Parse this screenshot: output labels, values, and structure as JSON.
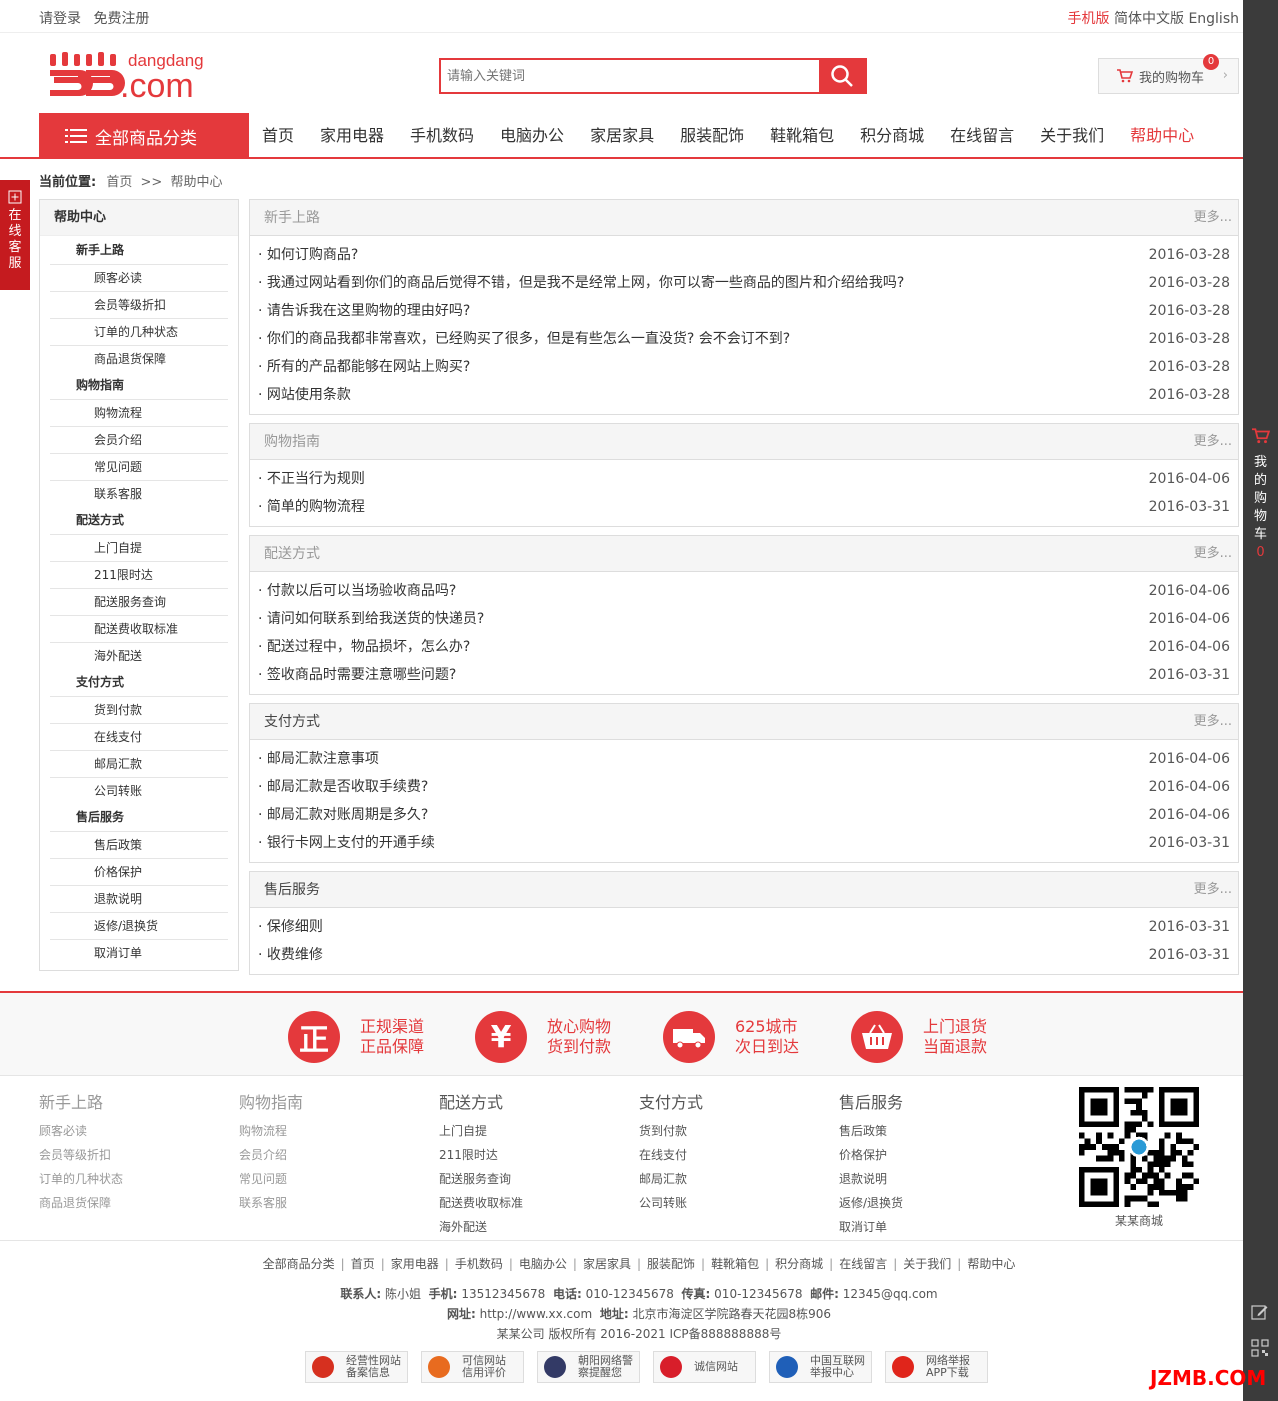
{
  "topbar": {
    "login": "请登录",
    "register": "免费注册",
    "mobile": "手机版",
    "lang_cn": "简体中文版",
    "lang_en": "English"
  },
  "logo": {
    "text": "dangdang",
    "domain": ".com"
  },
  "search": {
    "placeholder": "请输入关键词"
  },
  "cart": {
    "label": "我的购物车",
    "count": "0"
  },
  "nav": {
    "all_categories": "全部商品分类",
    "items": [
      "首页",
      "家用电器",
      "手机数码",
      "电脑办公",
      "家居家具",
      "服装配饰",
      "鞋靴箱包",
      "积分商城",
      "在线留言",
      "关于我们",
      "帮助中心"
    ]
  },
  "float_service": [
    "在",
    "线",
    "客",
    "服"
  ],
  "breadcrumb": {
    "label": "当前位置:",
    "home": "首页",
    "sep": ">>",
    "current": "帮助中心"
  },
  "sidebar": {
    "title": "帮助中心",
    "groups": [
      {
        "name": "新手上路",
        "items": [
          "顾客必读",
          "会员等级折扣",
          "订单的几种状态",
          "商品退货保障"
        ]
      },
      {
        "name": "购物指南",
        "items": [
          "购物流程",
          "会员介绍",
          "常见问题",
          "联系客服"
        ]
      },
      {
        "name": "配送方式",
        "items": [
          "上门自提",
          "211限时达",
          "配送服务查询",
          "配送费收取标准",
          "海外配送"
        ]
      },
      {
        "name": "支付方式",
        "items": [
          "货到付款",
          "在线支付",
          "邮局汇款",
          "公司转账"
        ]
      },
      {
        "name": "售后服务",
        "items": [
          "售后政策",
          "价格保护",
          "退款说明",
          "返修/退换货",
          "取消订单"
        ]
      }
    ]
  },
  "panels": [
    {
      "title": "新手上路",
      "more": "更多...",
      "rows": [
        {
          "t": "如何订购商品?",
          "d": "2016-03-28"
        },
        {
          "t": "我通过网站看到你们的商品后觉得不错，但是我不是经常上网，你可以寄一些商品的图片和介绍给我吗?",
          "d": "2016-03-28"
        },
        {
          "t": "请告诉我在这里购物的理由好吗?",
          "d": "2016-03-28"
        },
        {
          "t": "你们的商品我都非常喜欢，已经购买了很多，但是有些怎么一直没货? 会不会订不到?",
          "d": "2016-03-28"
        },
        {
          "t": "所有的产品都能够在网站上购买?",
          "d": "2016-03-28"
        },
        {
          "t": "网站使用条款",
          "d": "2016-03-28"
        }
      ]
    },
    {
      "title": "购物指南",
      "more": "更多...",
      "rows": [
        {
          "t": "不正当行为规则",
          "d": "2016-04-06"
        },
        {
          "t": "简单的购物流程",
          "d": "2016-03-31"
        }
      ]
    },
    {
      "title": "配送方式",
      "more": "更多...",
      "rows": [
        {
          "t": "付款以后可以当场验收商品吗?",
          "d": "2016-04-06"
        },
        {
          "t": "请问如何联系到给我送货的快递员?",
          "d": "2016-04-06"
        },
        {
          "t": "配送过程中，物品损坏，怎么办?",
          "d": "2016-04-06"
        },
        {
          "t": "签收商品时需要注意哪些问题?",
          "d": "2016-03-31"
        }
      ]
    },
    {
      "title": "支付方式",
      "more": "更多...",
      "rows": [
        {
          "t": "邮局汇款注意事项",
          "d": "2016-04-06"
        },
        {
          "t": "邮局汇款是否收取手续费?",
          "d": "2016-04-06"
        },
        {
          "t": "邮局汇款对账周期是多久?",
          "d": "2016-04-06"
        },
        {
          "t": "银行卡网上支付的开通手续",
          "d": "2016-03-31"
        }
      ]
    },
    {
      "title": "售后服务",
      "more": "更多...",
      "rows": [
        {
          "t": "保修细则",
          "d": "2016-03-31"
        },
        {
          "t": "收费维修",
          "d": "2016-03-31"
        }
      ]
    }
  ],
  "guarantees": [
    {
      "icon": "正",
      "l1": "正规渠道",
      "l2": "正品保障"
    },
    {
      "icon": "¥",
      "l1": "放心购物",
      "l2": "货到付款"
    },
    {
      "icon": "truck-icon",
      "l1": "625城市",
      "l2": "次日到达"
    },
    {
      "icon": "basket-icon",
      "l1": "上门退货",
      "l2": "当面退款"
    }
  ],
  "footer_cols": [
    {
      "title": "新手上路",
      "items": [
        "顾客必读",
        "会员等级折扣",
        "订单的几种状态",
        "商品退货保障"
      ]
    },
    {
      "title": "购物指南",
      "items": [
        "购物流程",
        "会员介绍",
        "常见问题",
        "联系客服"
      ]
    },
    {
      "title": "配送方式",
      "items": [
        "上门自提",
        "211限时达",
        "配送服务查询",
        "配送费收取标准",
        "海外配送"
      ]
    },
    {
      "title": "支付方式",
      "items": [
        "货到付款",
        "在线支付",
        "邮局汇款",
        "公司转账"
      ]
    },
    {
      "title": "售后服务",
      "items": [
        "售后政策",
        "价格保护",
        "退款说明",
        "返修/退换货",
        "取消订单"
      ]
    }
  ],
  "qr_label": "某某商城",
  "footer_links": [
    "全部商品分类",
    "首页",
    "家用电器",
    "手机数码",
    "电脑办公",
    "家居家具",
    "服装配饰",
    "鞋靴箱包",
    "积分商城",
    "在线留言",
    "关于我们",
    "帮助中心"
  ],
  "contact": {
    "k1": "联系人:",
    "v1": "陈小姐",
    "k2": "手机:",
    "v2": "13512345678",
    "k3": "电话:",
    "v3": "010-12345678",
    "k4": "传真:",
    "v4": "010-12345678",
    "k5": "邮件:",
    "v5": "12345@qq.com"
  },
  "site": {
    "k1": "网址:",
    "v1": "http://www.xx.com",
    "k2": "地址:",
    "v2": "北京市海淀区学院路春天花园8栋906"
  },
  "copyright": "某某公司 版权所有 2016-2021 ICP备888888888号",
  "badges": [
    {
      "l1": "经营性网站",
      "l2": "备案信息",
      "color": "#d6301f"
    },
    {
      "l1": "可信网站",
      "l2": "信用评价",
      "color": "#e86b1f"
    },
    {
      "l1": "朝阳网络警",
      "l2": "察提醒您",
      "color": "#333a66"
    },
    {
      "l1": "诚信网站",
      "l2": "",
      "color": "#d81e2a"
    },
    {
      "l1": "中国互联网",
      "l2": "举报中心",
      "color": "#1f5fb8"
    },
    {
      "l1": "网络举报",
      "l2": "APP下载",
      "color": "#e0251b"
    }
  ],
  "right_bar": {
    "cart_chars": [
      "我",
      "的",
      "购",
      "物",
      "车"
    ],
    "count": "0"
  },
  "watermark": "JZMB.COM",
  "colors": {
    "brand": "#e4393c",
    "sidebar_bar": "#3b3b3b"
  }
}
